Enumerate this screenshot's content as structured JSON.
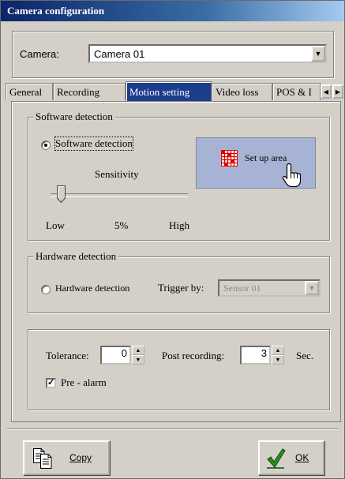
{
  "window": {
    "title": "Camera configuration"
  },
  "camera": {
    "label": "Camera:",
    "value": "Camera 01"
  },
  "tabs": [
    {
      "label": "General"
    },
    {
      "label": "Recording"
    },
    {
      "label": "Motion setting",
      "active": true
    },
    {
      "label": "Video loss"
    },
    {
      "label": "POS & I"
    }
  ],
  "software": {
    "group_label": "Software detection",
    "radio_label": "Software detection",
    "checked": true,
    "sensitivity_label": "Sensitivity",
    "sensitivity_value": 0.05,
    "low_label": "Low",
    "percent_label": "5%",
    "high_label": "High",
    "setup_button_label": "Set up area"
  },
  "hardware": {
    "group_label": "Hardware detection",
    "radio_label": "Hardware detection",
    "checked": false,
    "trigger_label": "Trigger by:",
    "trigger_value": "Sensor 01"
  },
  "recording": {
    "tolerance_label": "Tolerance:",
    "tolerance_value": "0",
    "post_label": "Post recording:",
    "post_value": "3",
    "sec_label": "Sec.",
    "prealarm_label": "Pre - alarm",
    "prealarm_checked": true
  },
  "buttons": {
    "copy_label": "Copy",
    "ok_label": "OK"
  },
  "colors": {
    "title_bar": "#0a246a",
    "active_tab": "#1c3c8c",
    "setup_button": "#a7b3d4",
    "grid_icon": "#e00000",
    "ok_check": "#2e8b1e"
  }
}
